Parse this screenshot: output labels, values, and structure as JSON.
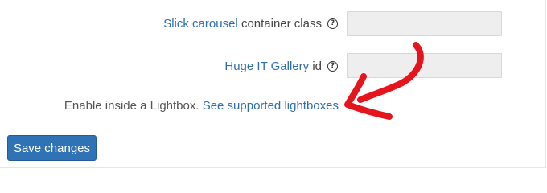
{
  "settings": {
    "slick_row": {
      "link_text": "Slick carousel",
      "label_text": "container class",
      "value": ""
    },
    "huge_it_row": {
      "link_text": "Huge IT Gallery",
      "label_text": "id",
      "value": ""
    },
    "lightbox_row": {
      "text": "Enable inside a Lightbox.",
      "link_text": "See supported lightboxes"
    },
    "help_glyph": "?"
  },
  "actions": {
    "save_label": "Save changes"
  },
  "annotation": {
    "arrow_color": "#e5141d",
    "icon": "hand-drawn-arrow"
  },
  "colors": {
    "link": "#2e6eb0",
    "button": "#2f73b6",
    "field_bg": "#eeeeee"
  }
}
